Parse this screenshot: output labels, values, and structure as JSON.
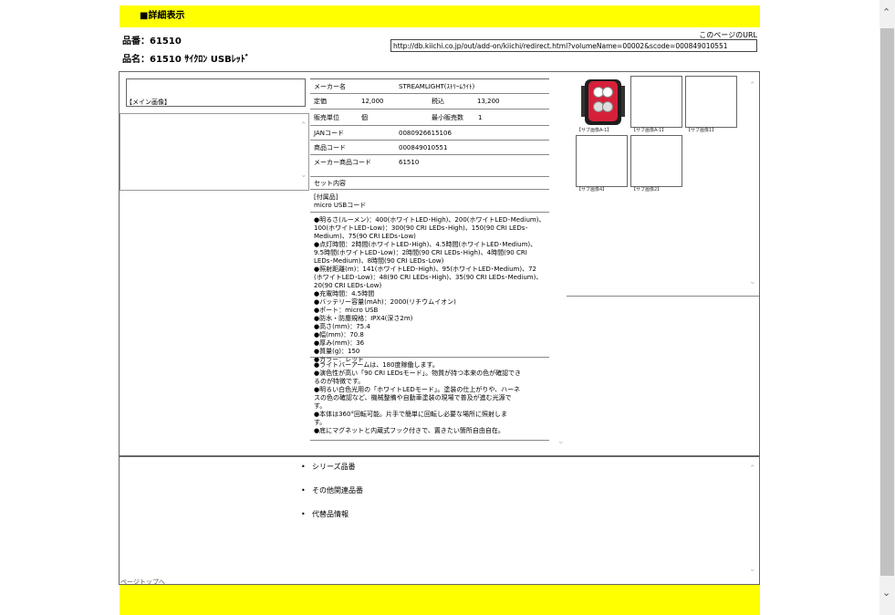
{
  "header": {
    "title": "■詳細表示"
  },
  "product": {
    "number_label": "品番：61510",
    "name_label": "品名：61510 ｻｲｸﾛﾝ USBﾚｯﾄﾞ"
  },
  "url_box": {
    "label": "このページのURL",
    "value": "http://db.kiichi.co.jp/out/add-on/kiichi/redirect.html?volumeName=00002&scode=000849010551"
  },
  "main_image": {
    "label": "【メイン画像】"
  },
  "specs": {
    "maker_label": "メーカー名",
    "maker_value": "STREAMLIGHT(ｽﾄﾘｰﾑﾗｲﾄ)",
    "price_label": "定価",
    "price_value": "12,000",
    "tax_label": "税込",
    "tax_value": "13,200",
    "unit_label": "販売単位",
    "unit_value": "個",
    "min_label": "最小販売数",
    "min_value": "1",
    "jan_label": "JANコード",
    "jan_value": "0080926615106",
    "code_label": "商品コード",
    "code_value": "000849010551",
    "maker_code_label": "メーカー商品コード",
    "maker_code_value": "61510",
    "set_label": "セット内容",
    "accessory_line1": "[付属品]",
    "accessory_line2": "micro USBコード",
    "spec_lines": [
      "●明るさ(ルーメン)：400(ホワイトLED･High)、200(ホワイトLED･Medium)、",
      "100(ホワイトLED･Low)：300(90 CRI LEDs･High)、150(90 CRI LEDs･",
      "Medium)、75(90 CRI LEDs･Low)",
      "●点灯時間：2時間(ホワイトLED･High)、4.5時間(ホワイトLED･Medium)、",
      "9.5時間(ホワイトLED･Low)：2時間(90 CRI LEDs･High)、4時間(90 CRI",
      "LEDs･Medium)、8時間(90 CRI LEDs･Low)",
      "●照射距離(m)：141(ホワイトLED･High)、95(ホワイトLED･Medium)、72",
      "(ホワイトLED･Low)：48(90 CRI LEDs･High)、35(90 CRI LEDs･Medium)、",
      "20(90 CRI LEDs･Low)",
      "●充電時間：4.5時間",
      "●バッテリー容量(mAh)：2000(リチウムイオン)",
      "●ポート：micro USB",
      "●防水・防塵規格：IPX4(深さ2m)",
      "●高さ(mm)：75.4",
      "●幅(mm)：70.8",
      "●厚み(mm)：36",
      "●質量(g)：150",
      "●カラー：レッド"
    ],
    "feature_lines": [
      "●ライトバーアームは、180度稼働します。",
      "●演色性が高い「90 CRI LEDsモード」。物質が持つ本来の色が確認でき",
      "るのが特徴です。",
      "●明るい白色光用の「ホワイトLEDモード」。塗装の仕上がりや、ハーネ",
      "スの色の確認など、機械整備や自動車塗装の現場で普及が進む光源で",
      "す。",
      "●本体は360°回転可能。片手で簡単に回転し必要な場所に照射しま",
      "す。",
      "●底にマグネットと内蔵式フック付きで、置きたい箇所自由自在。"
    ]
  },
  "sub_images": [
    {
      "label": "【サブ画像A-1】"
    },
    {
      "label": "【サブ画像A-1】"
    },
    {
      "label": "【サブ画像1】"
    },
    {
      "label": "【サブ画像4】"
    },
    {
      "label": "【サブ画像2】"
    }
  ],
  "links": [
    {
      "label": "シリーズ品番"
    },
    {
      "label": "その他関連品番"
    },
    {
      "label": "代替品情報"
    }
  ],
  "page_top": {
    "label": "ページトップへ"
  },
  "colors": {
    "header_bg": "#ffff00",
    "product_red": "#d6203a"
  },
  "icons": [
    "chevron-up-icon",
    "chevron-down-icon"
  ]
}
